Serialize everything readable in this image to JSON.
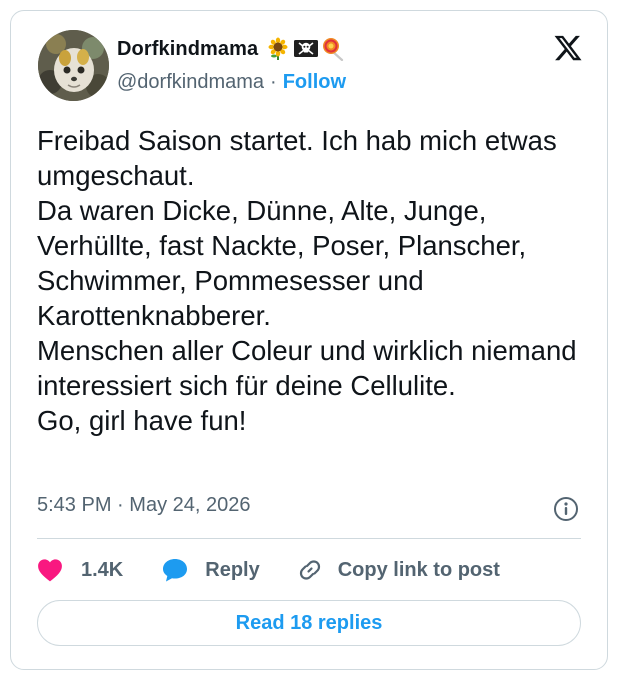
{
  "author": {
    "display_name": "Dorfkindmama",
    "handle": "@dorfkindmama",
    "separator": "·",
    "follow_label": "Follow",
    "name_emojis": [
      "sunflower-icon",
      "skull-crossbones-flag-icon",
      "lollipop-icon"
    ]
  },
  "brand": {
    "logo": "x-logo-icon"
  },
  "tweet": {
    "text": "Freibad Saison startet. Ich hab mich etwas umgeschaut.\nDa waren Dicke, Dünne, Alte, Junge, Verhüllte, fast Nackte, Poser, Planscher, Schwimmer, Pommesesser und Karottenknabberer.\nMenschen aller Coleur und wirklich niemand interessiert sich für deine Cellulite.\nGo, girl have fun!",
    "time": "5:43 PM",
    "separator": "·",
    "date": "May 24, 2026"
  },
  "actions": {
    "likes": "1.4K",
    "reply_label": "Reply",
    "copy_label": "Copy link to post"
  },
  "read_replies_label": "Read 18 replies",
  "colors": {
    "accent": "#1d9bf0",
    "like": "#f91880",
    "text": "#0f1419",
    "muted": "#536471",
    "border": "#cfd9de"
  }
}
